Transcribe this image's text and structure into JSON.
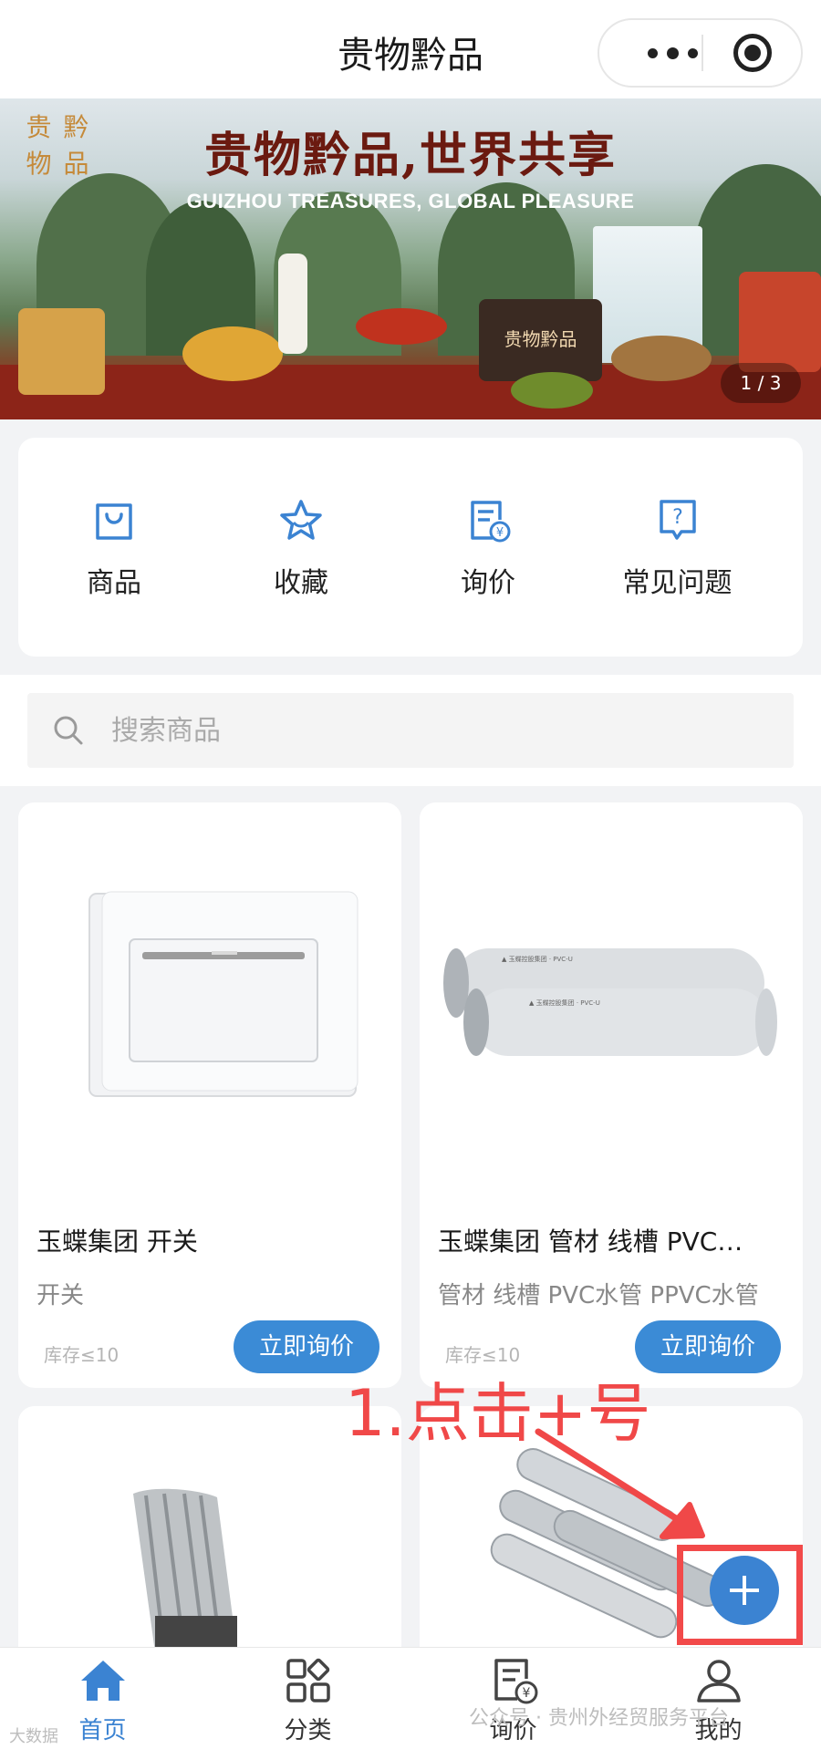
{
  "header": {
    "title": "贵物黔品"
  },
  "banner": {
    "logo_chars": [
      "贵",
      "黔",
      "物",
      "品"
    ],
    "slogan": "贵物黔品,世界共享",
    "subtitle": "GUIZHOU TREASURES, GLOBAL PLEASURE",
    "product_box_label": "贵物黔品",
    "pager": "1 / 3"
  },
  "quick_menu": [
    {
      "label": "商品",
      "icon": "shopping-bag-icon"
    },
    {
      "label": "收藏",
      "icon": "star-icon"
    },
    {
      "label": "询价",
      "icon": "price-inquiry-icon"
    },
    {
      "label": "常见问题",
      "icon": "question-icon"
    }
  ],
  "search": {
    "placeholder": "搜索商品"
  },
  "products": [
    {
      "name": "玉蝶集团 开关",
      "desc": "开关",
      "stock": "库存≤10",
      "button": "立即询价"
    },
    {
      "name": "玉蝶集团 管材 线槽 PVC…",
      "desc": "管材 线槽 PVC水管 PPVC水管",
      "stock": "库存≤10",
      "button": "立即询价"
    }
  ],
  "annotation": {
    "text": "1.点击+号"
  },
  "tabbar": [
    {
      "label": "首页",
      "icon": "home-icon",
      "active": true
    },
    {
      "label": "分类",
      "icon": "category-icon",
      "active": false
    },
    {
      "label": "询价",
      "icon": "price-inquiry-icon",
      "active": false
    },
    {
      "label": "我的",
      "icon": "user-icon",
      "active": false
    }
  ],
  "watermark": {
    "text": "公众号 · 贵州外经贸服务平台",
    "corner": "大数据"
  },
  "colors": {
    "accent": "#3b83d2",
    "annotation": "#f04848"
  }
}
